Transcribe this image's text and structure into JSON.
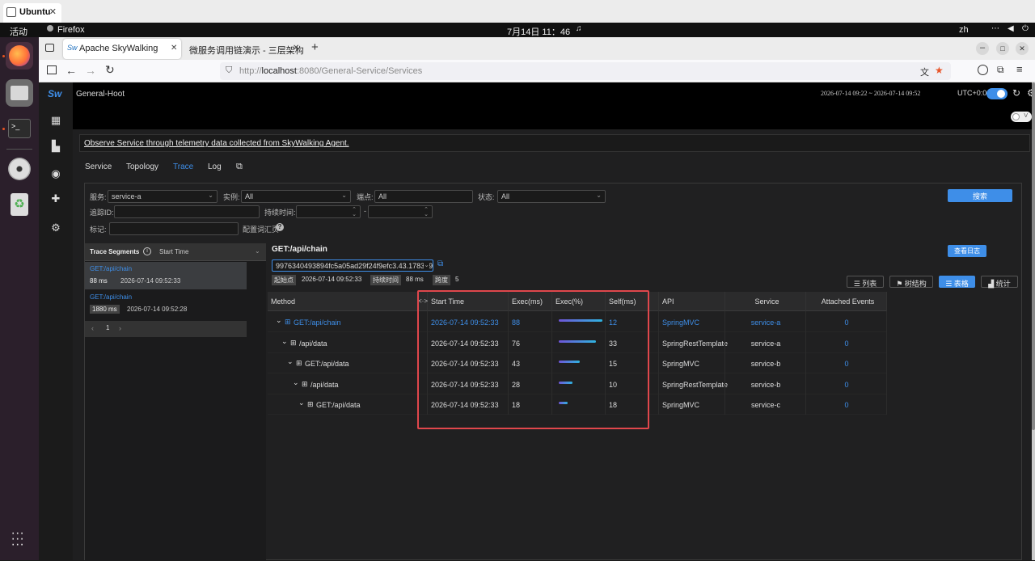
{
  "vm_tab": {
    "label": "Ubuntu",
    "close": "✕"
  },
  "gnome": {
    "activities": "活动",
    "app": "Firefox",
    "clock": "7月14日  11：46",
    "lang": "zh"
  },
  "browser": {
    "tabs": [
      {
        "label": "Apache SkyWalking",
        "close": "✕"
      },
      {
        "label": "微服务调用链演示 - 三层架构",
        "close": "✕"
      }
    ],
    "new_tab": "+",
    "url_prefix": "http://",
    "url_host": "localhost",
    "url_rest": ":8080/General-Service/Services"
  },
  "app": {
    "logo": "Sw",
    "layer": "General-Hoot",
    "time_range": "2026-07-14 09:22 ~ 2026-07-14 09:52",
    "timezone": "UTC+0:0",
    "toggle_label": "V",
    "notice": "Observe Service through telemetry data collected from SkyWalking Agent.",
    "tabs": [
      "Service",
      "Topology",
      "Trace",
      "Log"
    ],
    "active_tab": "Trace"
  },
  "filters": {
    "service_label": "服务:",
    "service_value": "service-a",
    "instance_label": "实例:",
    "instance_value": "All",
    "endpoint_label": "端点:",
    "endpoint_value": "All",
    "status_label": "状态:",
    "status_value": "All",
    "search_button": "搜索",
    "trace_id_label": "追踪ID:",
    "duration_label": "持续时间:",
    "duration_sep": "-",
    "tags_label": "标记:",
    "tags_config": "配置词汇页",
    "help": "?"
  },
  "segments": {
    "title": "Trace Segments",
    "sort": "Start Time",
    "items": [
      {
        "endpoint": "GET:/api/chain",
        "duration": "88 ms",
        "time": "2026-07-14 09:52:33"
      },
      {
        "endpoint": "GET:/api/chain",
        "duration": "1880 ms",
        "time": "2026-07-14 09:52:28"
      }
    ],
    "pager": {
      "prev": "‹",
      "page": "1",
      "next": "›"
    }
  },
  "trace": {
    "title": "GET:/api/chain",
    "trace_id": "9976340493894fc5a05ad29f24f9efc3.43.1783993",
    "view_logs": "查看日志",
    "start_label": "起始点",
    "start_value": "2026-07-14 09:52:33",
    "duration_label": "持续时间",
    "duration_value": "88 ms",
    "span_label": "跨度",
    "span_value": "5",
    "views": [
      "列表",
      "树结构",
      "表格",
      "统计"
    ],
    "active_view": "表格",
    "columns": [
      "Method",
      "Start Time",
      "Exec(ms)",
      "Exec(%)",
      "Self(ms)",
      "API",
      "Service",
      "Attached Events"
    ],
    "resize_handle": "<·>",
    "rows": [
      {
        "method": "GET:/api/chain",
        "start": "2026-07-14 09:52:33",
        "exec": "88",
        "exec_pct": 100,
        "self": "12",
        "api": "SpringMVC",
        "service": "service-a",
        "events": "0",
        "depth": 0,
        "highlight": true
      },
      {
        "method": "/api/data",
        "start": "2026-07-14 09:52:33",
        "exec": "76",
        "exec_pct": 86,
        "self": "33",
        "api": "SpringRestTemplate",
        "service": "service-a",
        "events": "0",
        "depth": 1,
        "highlight": false
      },
      {
        "method": "GET:/api/data",
        "start": "2026-07-14 09:52:33",
        "exec": "43",
        "exec_pct": 49,
        "self": "15",
        "api": "SpringMVC",
        "service": "service-b",
        "events": "0",
        "depth": 2,
        "highlight": false
      },
      {
        "method": "/api/data",
        "start": "2026-07-14 09:52:33",
        "exec": "28",
        "exec_pct": 32,
        "self": "10",
        "api": "SpringRestTemplate",
        "service": "service-b",
        "events": "0",
        "depth": 3,
        "highlight": false
      },
      {
        "method": "GET:/api/data",
        "start": "2026-07-14 09:52:33",
        "exec": "18",
        "exec_pct": 20,
        "self": "18",
        "api": "SpringMVC",
        "service": "service-c",
        "events": "0",
        "depth": 4,
        "highlight": false
      }
    ]
  },
  "colors": {
    "accent": "#3e8ee8",
    "highlight_box": "#e0474c",
    "bar_start": "#6f55d8",
    "bar_end": "#2fb3e0"
  }
}
